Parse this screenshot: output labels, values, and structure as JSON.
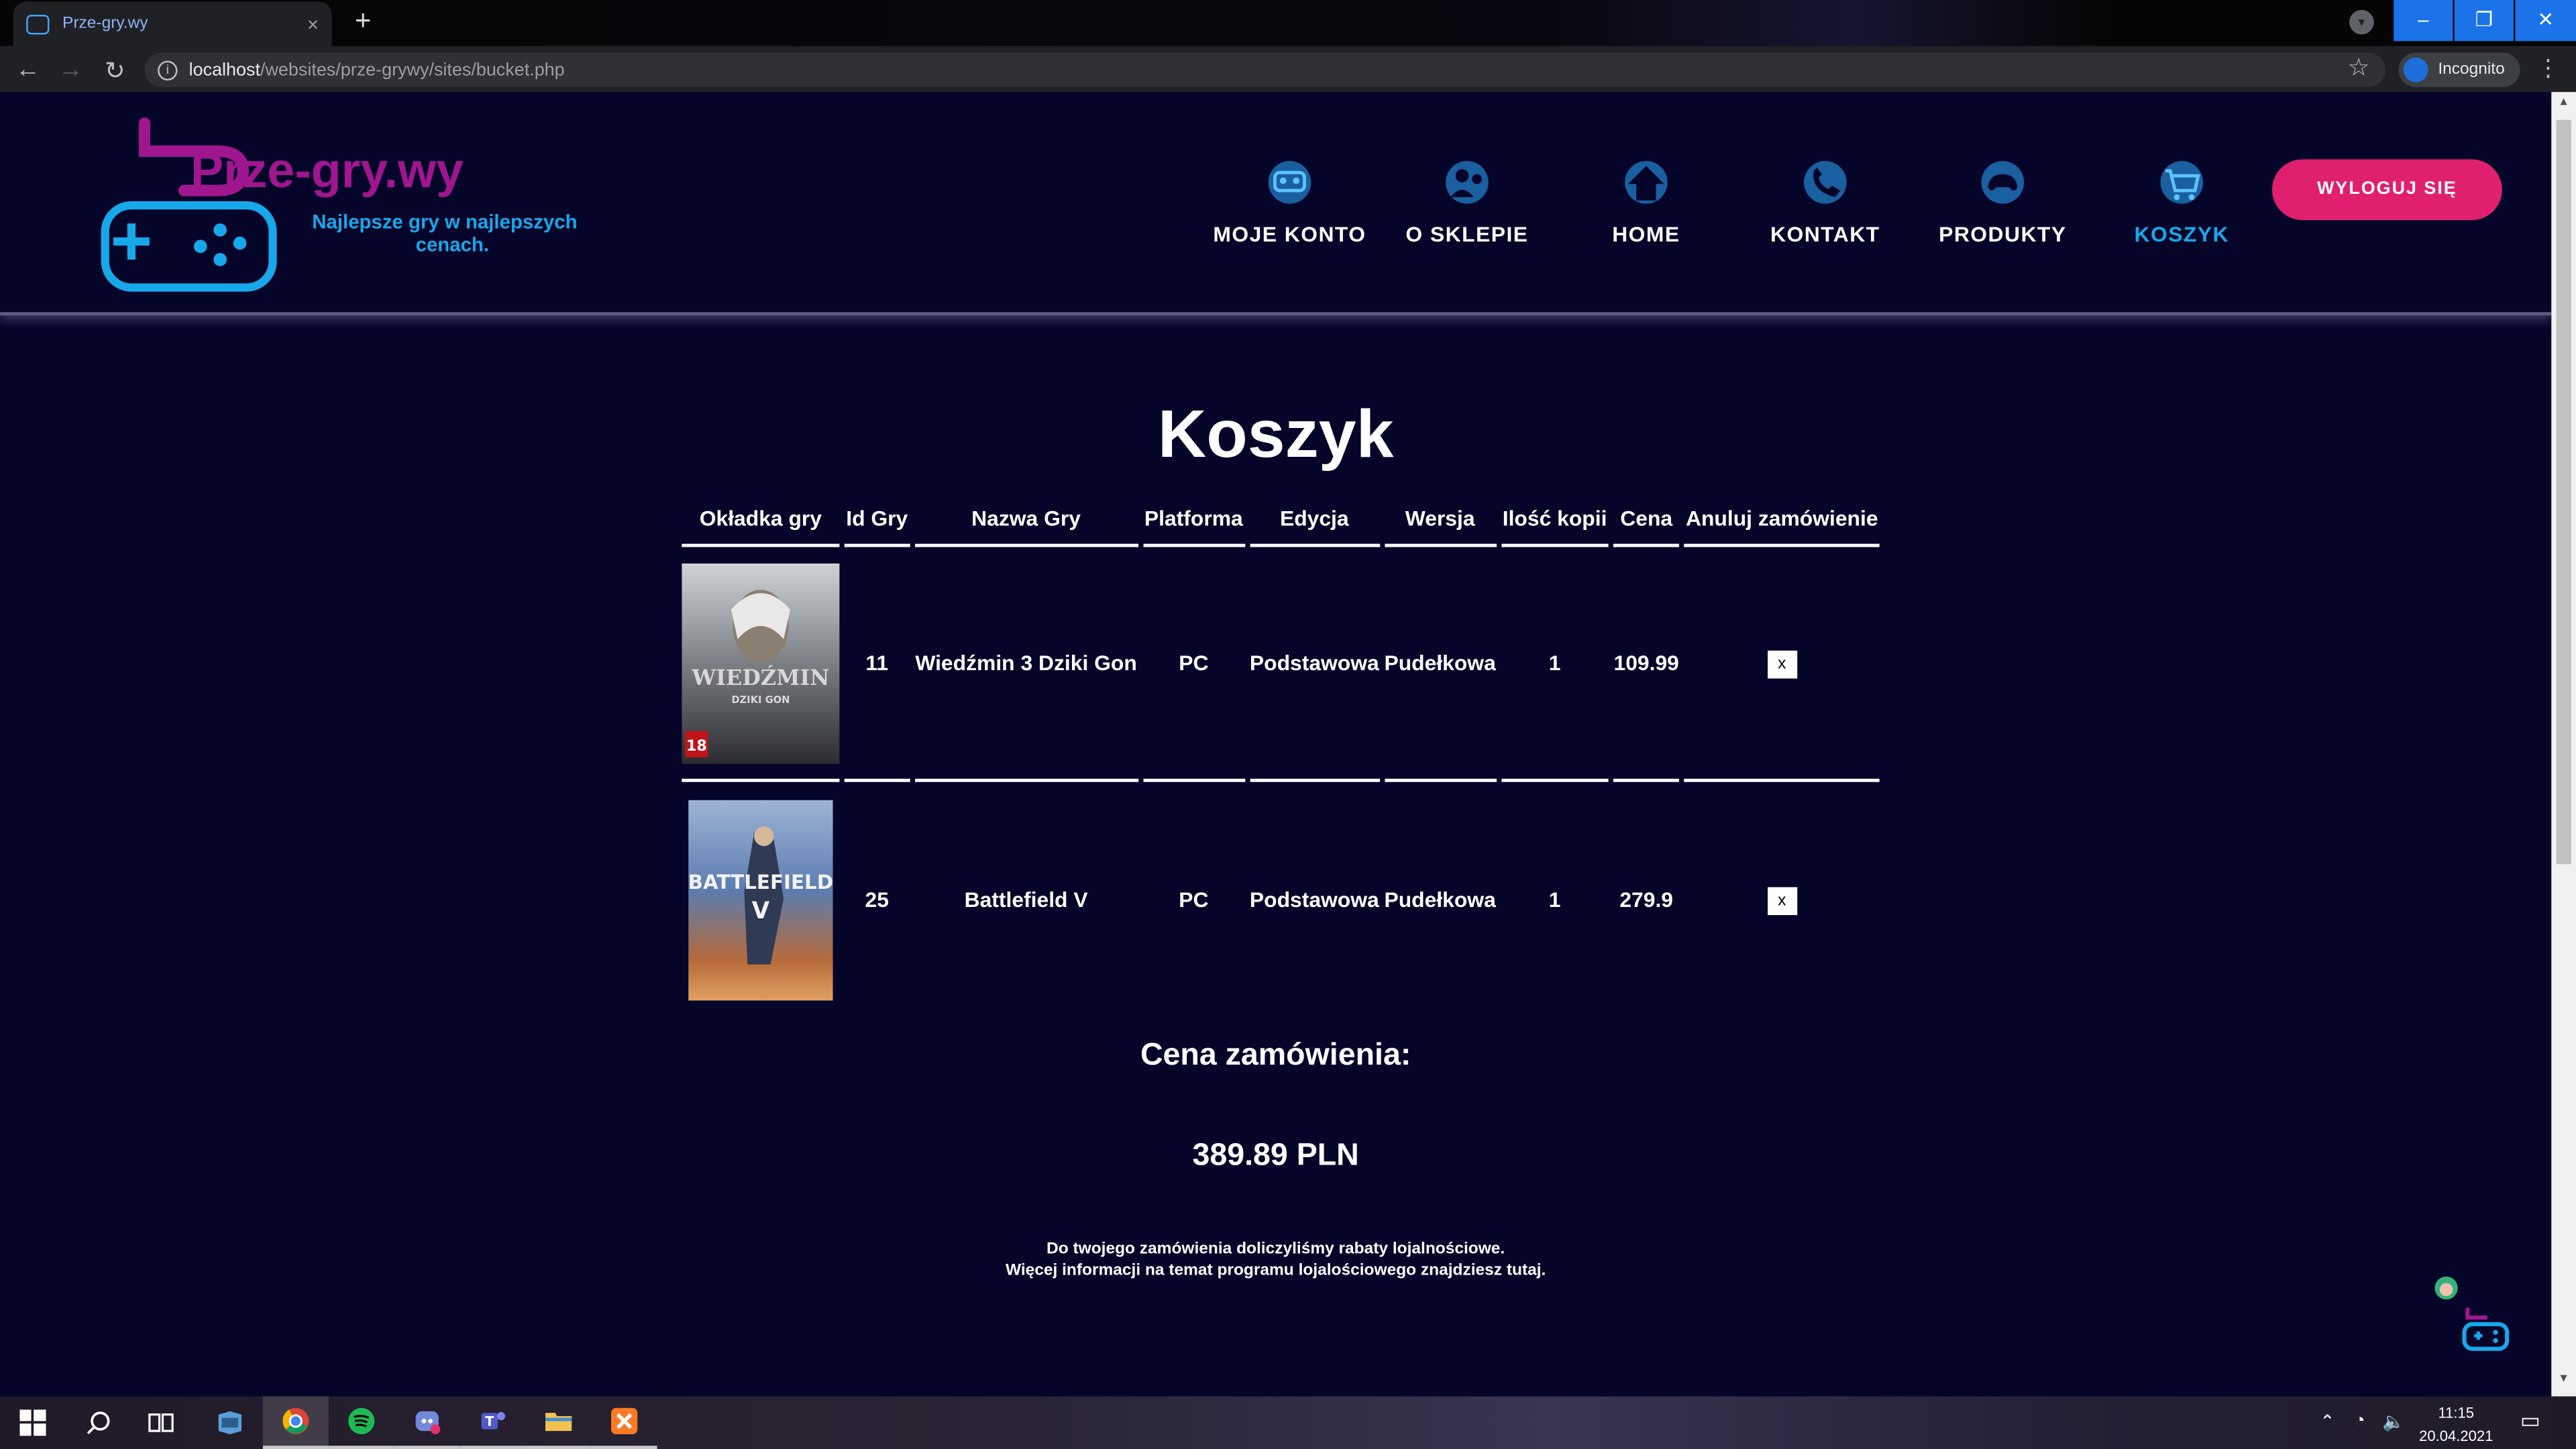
{
  "browser": {
    "tab_title": "Prze-gry.wy",
    "tab_close": "×",
    "new_tab": "+",
    "url_host": "localhost",
    "url_path": "/websites/prze-grywy/sites/bucket.php",
    "profile_label": "Incognito",
    "window_controls": {
      "minimize": "–",
      "restore": "❐",
      "close": "✕"
    }
  },
  "header": {
    "brand": "Prze-gry.wy",
    "tagline_line1": "Najlepsze gry w najlepszych",
    "tagline_line2": "cenach.",
    "nav": [
      {
        "label": "MOJE KONTO",
        "icon": "account-icon"
      },
      {
        "label": "O SKLEPIE",
        "icon": "about-store-icon"
      },
      {
        "label": "HOME",
        "icon": "home-icon"
      },
      {
        "label": "KONTAKT",
        "icon": "phone-icon"
      },
      {
        "label": "PRODUKTY",
        "icon": "gamepad-icon"
      },
      {
        "label": "KOSZYK",
        "icon": "cart-icon",
        "active": true
      }
    ],
    "logout_label": "WYLOGUJ SIĘ"
  },
  "cart": {
    "heading": "Koszyk",
    "columns": [
      "Okładka gry",
      "Id Gry",
      "Nazwa Gry",
      "Platforma",
      "Edycja",
      "Wersja",
      "Ilość kopii",
      "Cena",
      "Anuluj zamówienie"
    ],
    "rows": [
      {
        "id": "11",
        "name": "Wiedźmin 3 Dziki Gon",
        "platform": "PC",
        "edition": "Podstawowa",
        "version": "Pudełkowa",
        "qty": "1",
        "price": "109.99",
        "cancel": "x",
        "cover_text": "WIEDŹMIN",
        "cover_sub": "DZIKI GON",
        "cover_age": "18"
      },
      {
        "id": "25",
        "name": "Battlefield V",
        "platform": "PC",
        "edition": "Podstawowa",
        "version": "Pudełkowa",
        "qty": "1",
        "price": "279.9",
        "cancel": "x",
        "cover_text": "BATTLEFIELD",
        "cover_sub": "V"
      }
    ],
    "total_label": "Cena zamówienia:",
    "total_value": "389.89 PLN",
    "note_line1": "Do twojego zamówienia doliczyliśmy rabaty lojalnościowe.",
    "note_line2": "Więcej informacji na temat programu lojalościowego znajdziesz tutaj."
  },
  "taskbar": {
    "time": "11:15",
    "date": "20.04.2021",
    "apps": [
      "windows-start-icon",
      "search-icon",
      "task-view-icon",
      "edge-icon",
      "chrome-icon",
      "spotify-icon",
      "discord-icon",
      "teams-icon",
      "file-explorer-icon",
      "xampp-icon"
    ]
  },
  "colors": {
    "bg": "#05052a",
    "accent": "#17a8ea",
    "brand": "#a0168f",
    "logout": "#e0206e"
  }
}
